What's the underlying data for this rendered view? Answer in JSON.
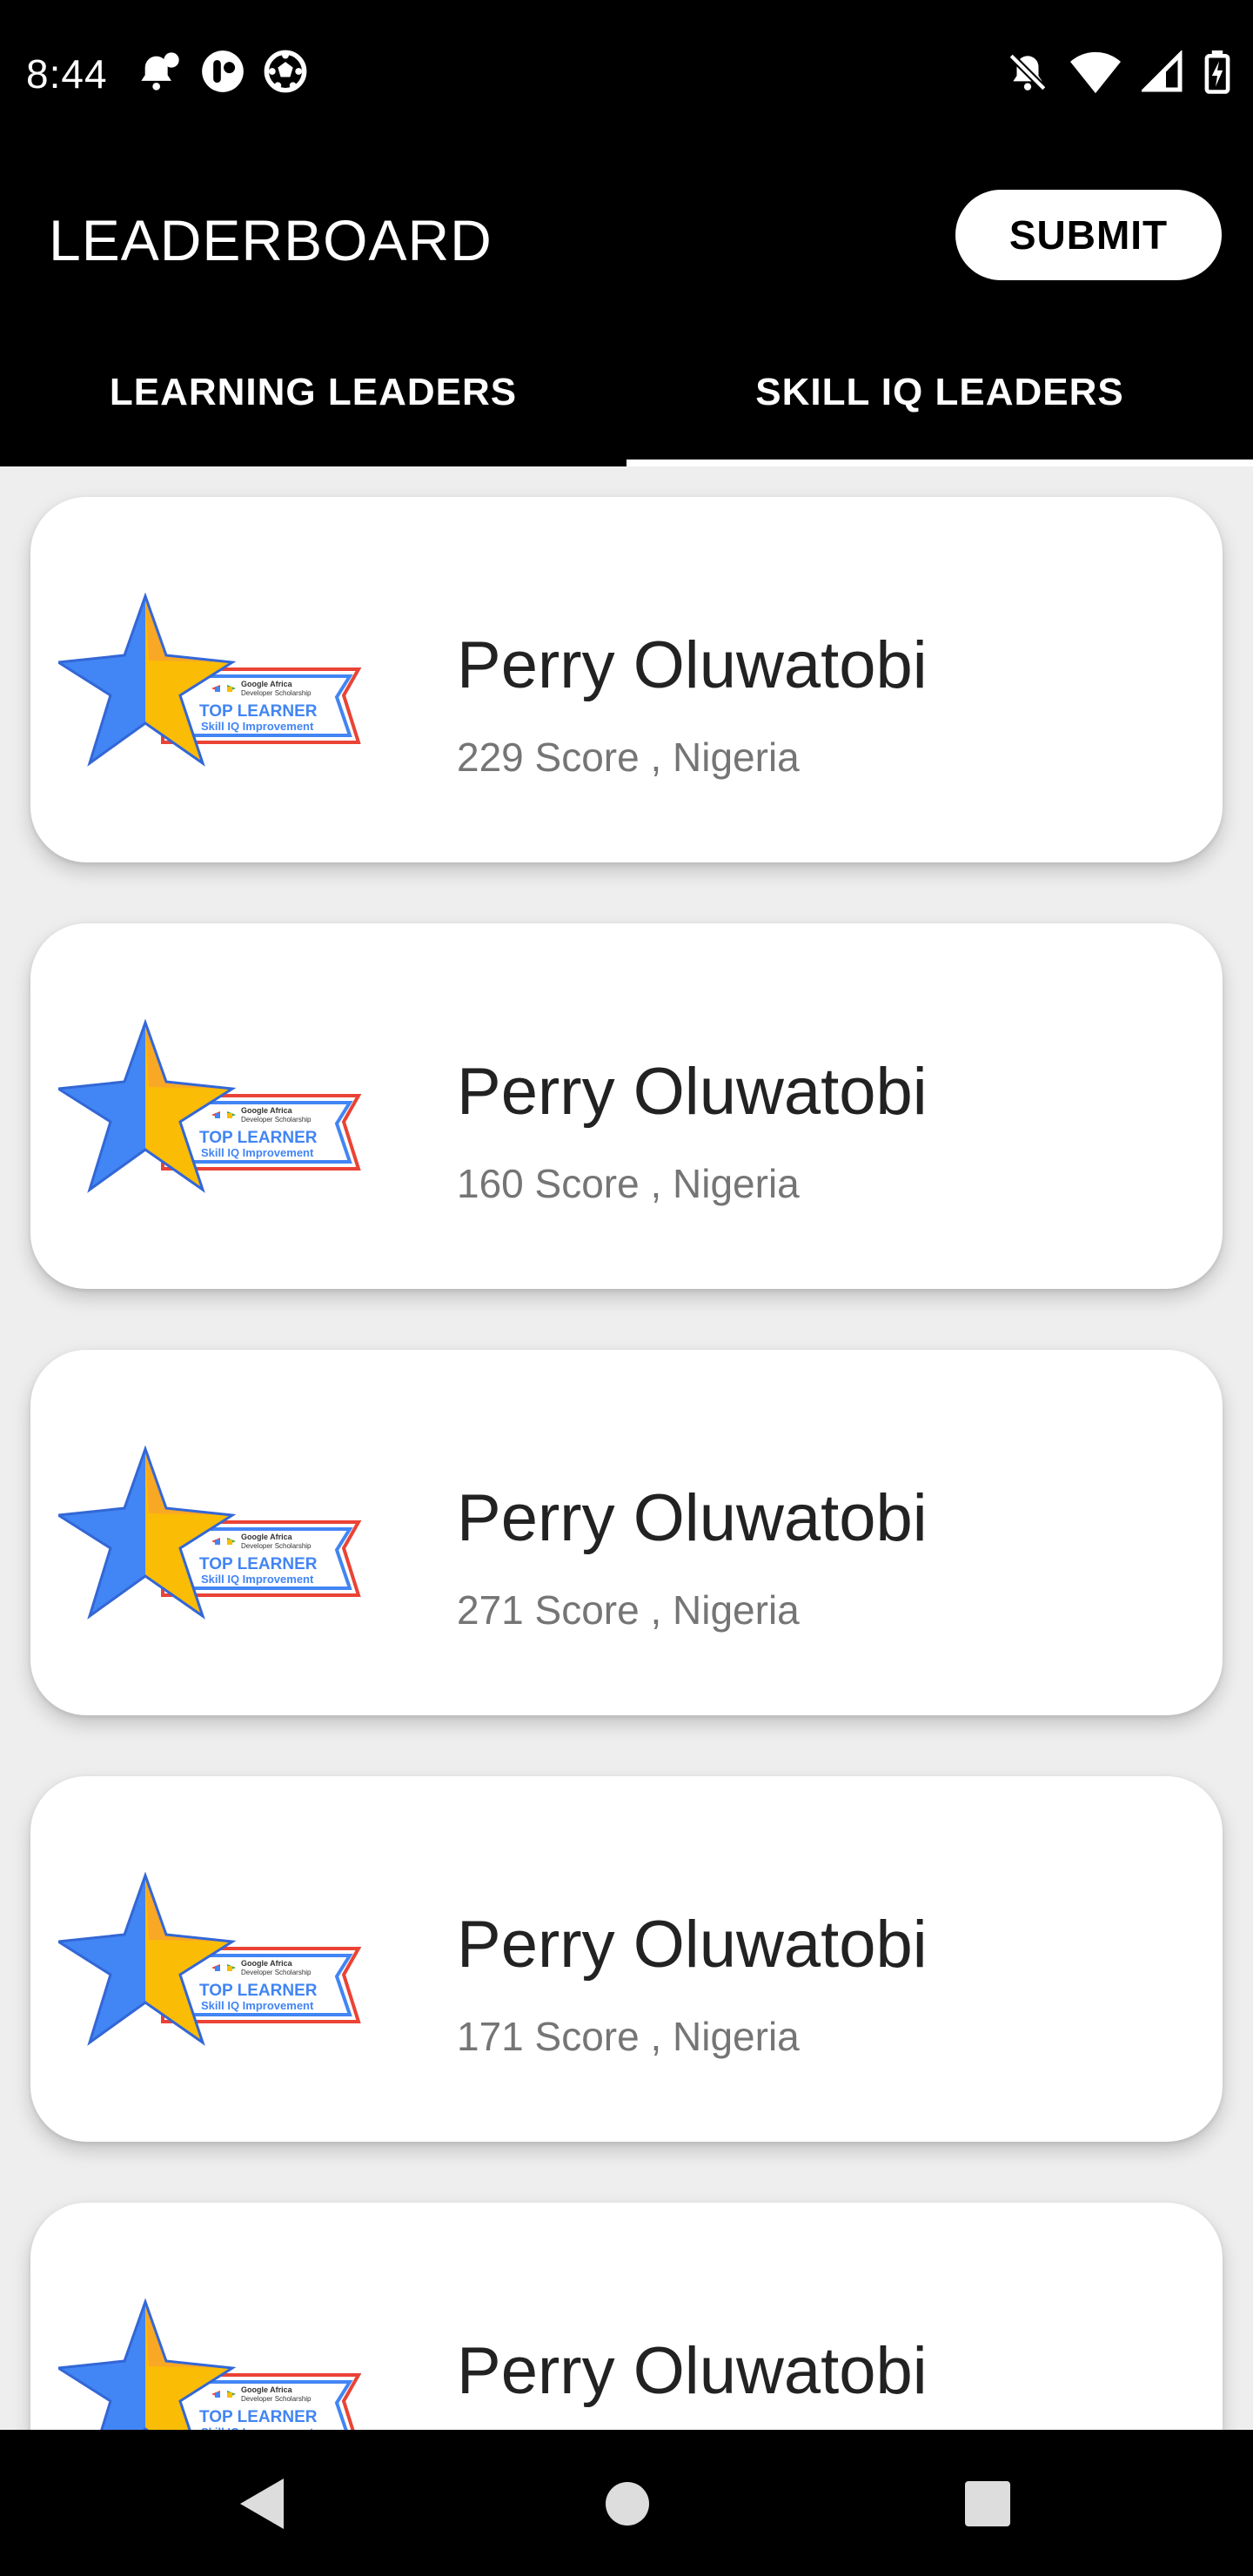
{
  "status_bar": {
    "time": "8:44",
    "icons_left": [
      "notification-bell-icon",
      "app-icon",
      "soccer-ball-icon"
    ],
    "icons_right": [
      "vibrate-off-icon",
      "wifi-icon",
      "signal-icon",
      "battery-charging-icon"
    ]
  },
  "app_bar": {
    "title": "LEADERBOARD",
    "submit_label": "SUBMIT"
  },
  "tabs": [
    {
      "label": "LEARNING LEADERS",
      "active": false
    },
    {
      "label": "SKILL IQ LEADERS",
      "active": true
    }
  ],
  "badge": {
    "line1": "Google Africa",
    "line2": "Developer Scholarship",
    "line3": "TOP LEARNER",
    "line4": "Skill IQ Improvement"
  },
  "leaders": [
    {
      "name": "Perry Oluwatobi",
      "detail": "229 Score , Nigeria"
    },
    {
      "name": "Perry Oluwatobi",
      "detail": "160 Score , Nigeria"
    },
    {
      "name": "Perry Oluwatobi",
      "detail": "271 Score , Nigeria"
    },
    {
      "name": "Perry Oluwatobi",
      "detail": "171 Score , Nigeria"
    },
    {
      "name": "Perry Oluwatobi",
      "detail": ""
    }
  ],
  "colors": {
    "app_bar": "#000000",
    "background": "#eeeeee",
    "star_blue": "#4285f4",
    "star_yellow": "#fbbc05",
    "badge_red": "#ea4335"
  }
}
